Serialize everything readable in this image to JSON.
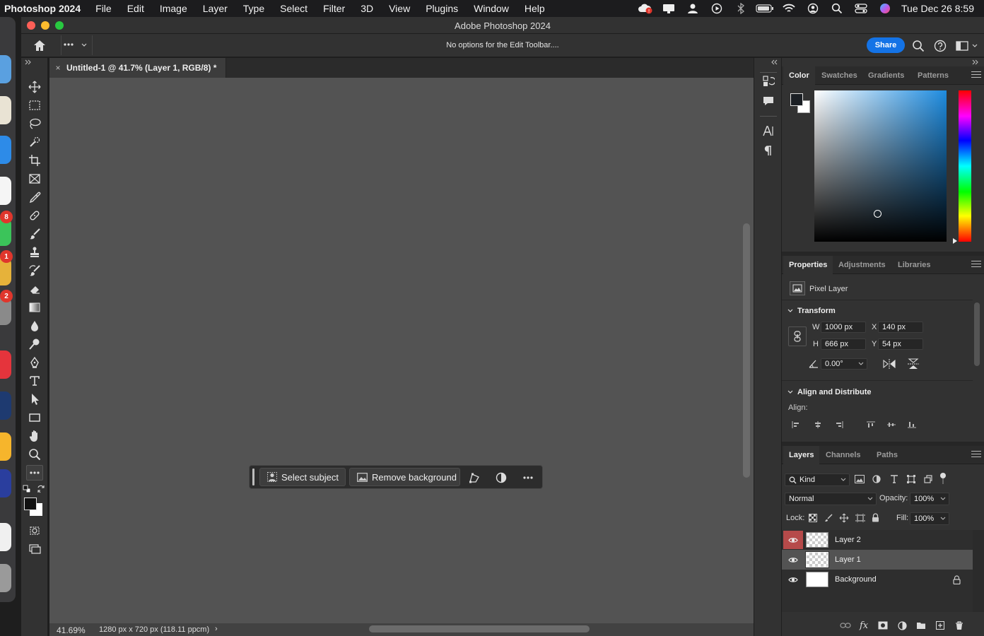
{
  "menubar": {
    "app_name": "Photoshop 2024",
    "menus": [
      "File",
      "Edit",
      "Image",
      "Layer",
      "Type",
      "Select",
      "Filter",
      "3D",
      "View",
      "Plugins",
      "Window",
      "Help"
    ],
    "clock": "Tue Dec 26  8:59"
  },
  "dock": {
    "badges": [
      "8",
      "1",
      "2"
    ]
  },
  "window": {
    "title": "Adobe Photoshop 2024"
  },
  "options_bar": {
    "message": "No options for the Edit Toolbar....",
    "share_label": "Share"
  },
  "document": {
    "tab_title": "Untitled-1 @ 41.7% (Layer 1, RGB/8) *",
    "tab_close": "×"
  },
  "status_bar": {
    "zoom": "41.69%",
    "doc_info": "1280 px x 720 px (118.11 ppcm)",
    "arrow": "›"
  },
  "contextual_taskbar": {
    "select_subject": "Select subject",
    "remove_background": "Remove background"
  },
  "color_panel": {
    "tabs": [
      "Color",
      "Swatches",
      "Gradients",
      "Patterns"
    ],
    "active_tab": "Color",
    "foreground_color": "#1b1f24",
    "hue_color": "#1e8ce0"
  },
  "properties_panel": {
    "tabs": [
      "Properties",
      "Adjustments",
      "Libraries"
    ],
    "active_tab": "Properties",
    "layer_type": "Pixel Layer",
    "transform_title": "Transform",
    "w_label": "W",
    "w_value": "1000 px",
    "x_label": "X",
    "x_value": "140 px",
    "h_label": "H",
    "h_value": "666 px",
    "y_label": "Y",
    "y_value": "54 px",
    "angle_value": "0.00°",
    "align_title": "Align and Distribute",
    "align_label": "Align:"
  },
  "layers_panel": {
    "tabs": [
      "Layers",
      "Channels",
      "Paths"
    ],
    "active_tab": "Layers",
    "filter_kind": "Kind",
    "blend_mode": "Normal",
    "opacity_label": "Opacity:",
    "opacity_value": "100%",
    "lock_label": "Lock:",
    "fill_label": "Fill:",
    "fill_value": "100%",
    "layers": [
      {
        "name": "Layer 2",
        "visible": true,
        "selected": false,
        "transparent": true
      },
      {
        "name": "Layer 1",
        "visible": true,
        "selected": true,
        "transparent": true
      },
      {
        "name": "Background",
        "visible": true,
        "selected": false,
        "transparent": false,
        "locked": true
      }
    ]
  }
}
